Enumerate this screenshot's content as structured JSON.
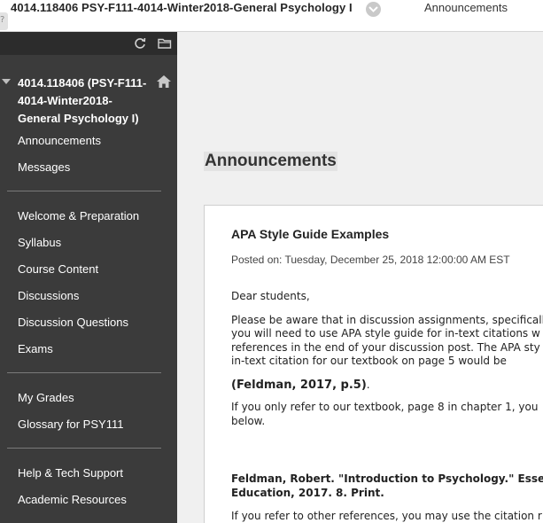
{
  "topbar": {
    "course_title": "4014.118406 PSY-F111-4014-Winter2018-General Psychology I",
    "breadcrumb": "Announcements",
    "help_glyph": "?"
  },
  "sidebar": {
    "course_name": "4014.118406 (PSY-F111-4014-Winter2018-General Psychology I)",
    "groups": [
      [
        "Announcements",
        "Messages"
      ],
      [
        "Welcome & Preparation",
        "Syllabus",
        "Course Content",
        "Discussions",
        "Discussion Questions",
        "Exams"
      ],
      [
        "My Grades",
        "Glossary for PSY111"
      ],
      [
        "Help & Tech Support",
        "Academic Resources"
      ]
    ],
    "icons": [
      "refresh-icon",
      "folder-icon",
      "home-icon",
      "collapse-triangle-icon"
    ]
  },
  "main": {
    "page_title": "Announcements",
    "announcement": {
      "title": "APA Style Guide Examples",
      "posted": "Posted on: Tuesday, December 25, 2018 12:00:00 AM EST",
      "greeting": "Dear students,",
      "para1": [
        "Please be aware that in discussion assignments, specificall",
        "you will need to use APA style guide for in-text citations w",
        "references in the end of your discussion post. The APA sty",
        "in-text citation for our textbook on page 5 would be"
      ],
      "citation_example": "(Feldman, 2017, p.5)",
      "citation_suffix": ".",
      "para2": [
        "If you only refer to our textbook, page 8 in chapter 1, you",
        "below."
      ],
      "reference": [
        "Feldman, Robert. \"Introduction to Psychology.\" Esse",
        "Education, 2017. 8. Print."
      ],
      "para3": "If you refer to other references, you may use the citation r"
    }
  },
  "colors": {
    "sidebar_bg": "#3b3b3b",
    "sidebar_tools_bg": "#2c2c2c",
    "main_bg": "#f0f0f0",
    "card_bg": "#ffffff"
  }
}
